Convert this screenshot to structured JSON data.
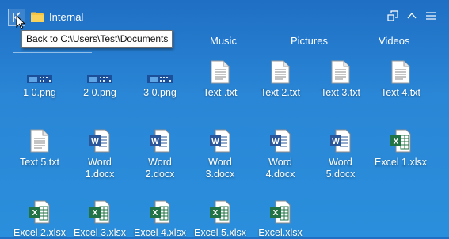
{
  "window": {
    "title": "Internal",
    "back_tooltip": "Back to C:\\Users\\Test\\Documents"
  },
  "tabs": [
    "Music",
    "Pictures",
    "Videos"
  ],
  "files": [
    {
      "label": "1 0.png",
      "type": "image"
    },
    {
      "label": "2 0.png",
      "type": "image"
    },
    {
      "label": "3 0.png",
      "type": "image"
    },
    {
      "label": "Text .txt",
      "type": "text"
    },
    {
      "label": "Text 2.txt",
      "type": "text"
    },
    {
      "label": "Text 3.txt",
      "type": "text"
    },
    {
      "label": "Text 4.txt",
      "type": "text"
    },
    {
      "label": "Text 5.txt",
      "type": "text"
    },
    {
      "label": "Word\n1.docx",
      "type": "word"
    },
    {
      "label": "Word\n2.docx",
      "type": "word"
    },
    {
      "label": "Word\n3.docx",
      "type": "word"
    },
    {
      "label": "Word\n4.docx",
      "type": "word"
    },
    {
      "label": "Word\n5.docx",
      "type": "word"
    },
    {
      "label": "Excel 1.xlsx",
      "type": "excel"
    },
    {
      "label": "Excel 2.xlsx",
      "type": "excel"
    },
    {
      "label": "Excel 3.xlsx",
      "type": "excel"
    },
    {
      "label": "Excel 4.xlsx",
      "type": "excel"
    },
    {
      "label": "Excel 5.xlsx",
      "type": "excel"
    },
    {
      "label": "Excel.xlsx",
      "type": "excel"
    }
  ],
  "icons": {
    "back": "back-arrow-icon",
    "folder": "folder-icon",
    "restore": "restore-window-icon",
    "collapse": "chevron-up-icon",
    "menu": "hamburger-menu-icon"
  },
  "colors": {
    "background": "#2a86d6",
    "word": "#2b579a",
    "excel": "#217346",
    "folder": "#f6c443"
  }
}
